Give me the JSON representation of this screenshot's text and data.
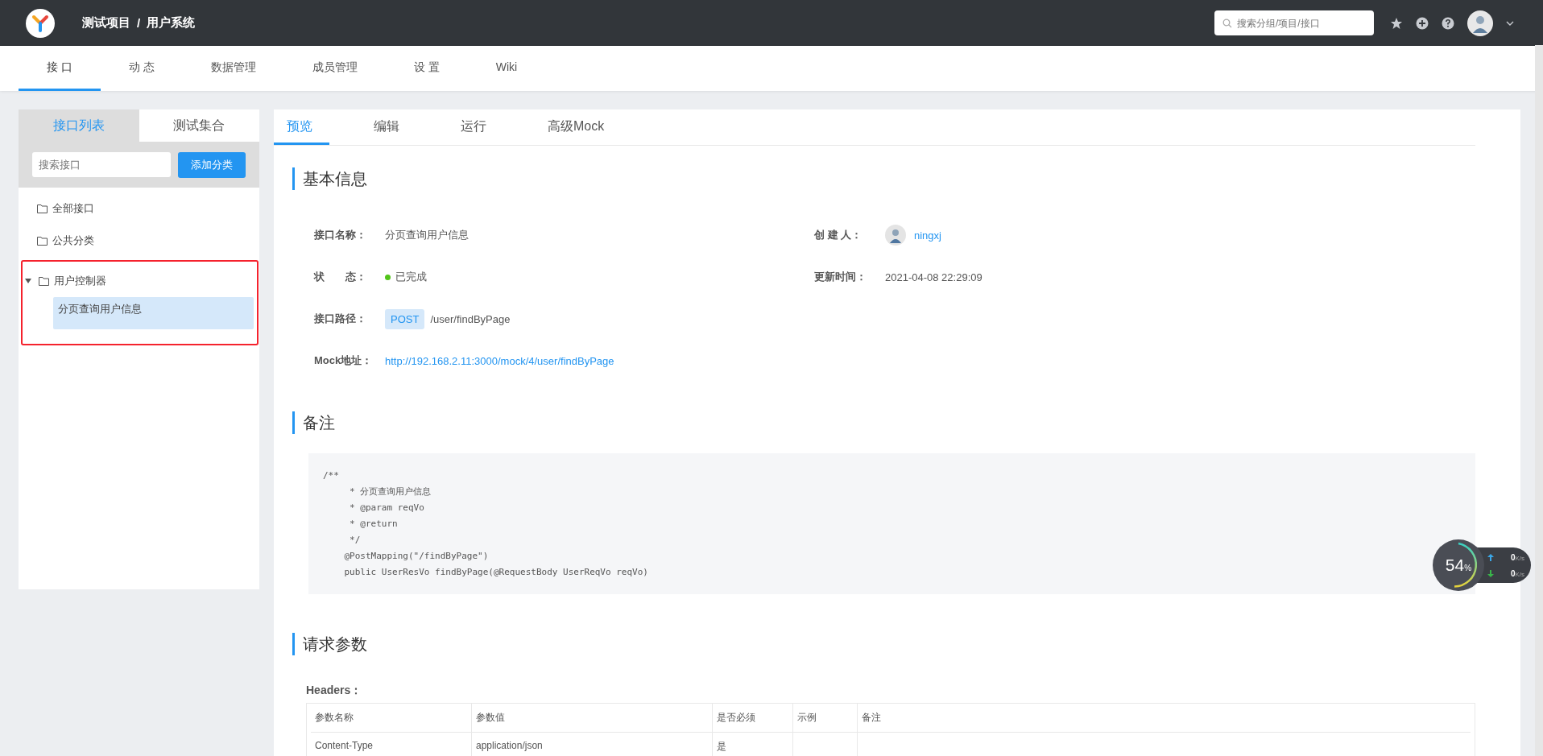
{
  "header": {
    "project": "测试项目",
    "separator": "/",
    "group": "用户系统",
    "search": {
      "placeholder": "搜索分组/项目/接口"
    }
  },
  "nav_tabs": [
    {
      "label": "接 口",
      "selected": true
    },
    {
      "label": "动 态",
      "selected": false
    },
    {
      "label": "数据管理",
      "selected": false
    },
    {
      "label": "成员管理",
      "selected": false
    },
    {
      "label": "设 置",
      "selected": false
    },
    {
      "label": "Wiki",
      "selected": false
    }
  ],
  "sidebar": {
    "tabs": [
      {
        "label": "接口列表",
        "selected": true
      },
      {
        "label": "测试集合",
        "selected": false
      }
    ],
    "search": {
      "placeholder": "搜索接口"
    },
    "add_button": "添加分类",
    "tree": [
      {
        "label": "全部接口"
      },
      {
        "label": "公共分类"
      },
      {
        "label": "用户控制器",
        "highlighted": true,
        "expanded": true,
        "children": [
          {
            "label": "分页查询用户信息",
            "selected": true
          }
        ]
      }
    ]
  },
  "content_tabs": [
    {
      "label": "预览",
      "selected": true
    },
    {
      "label": "编辑",
      "selected": false
    },
    {
      "label": "运行",
      "selected": false
    },
    {
      "label": "高级Mock",
      "selected": false
    }
  ],
  "basic_info": {
    "title": "基本信息",
    "name": {
      "label": "接口名称：",
      "value": "分页查询用户信息"
    },
    "creator": {
      "label": "创 建 人：",
      "value": "ningxj"
    },
    "status": {
      "label": "状　　态：",
      "value": "已完成"
    },
    "updated": {
      "label": "更新时间：",
      "value": "2021-04-08 22:29:09"
    },
    "path": {
      "label": "接口路径：",
      "method": "POST",
      "value": "/user/findByPage"
    },
    "mock": {
      "label": "Mock地址：",
      "value": "http://192.168.2.11:3000/mock/4/user/findByPage"
    }
  },
  "remarks": {
    "title": "备注",
    "code": [
      "/**",
      "     * 分页查询用户信息",
      "     * @param reqVo",
      "     * @return",
      "     */",
      "    @PostMapping(\"/findByPage\")",
      "    public UserResVo findByPage(@RequestBody UserReqVo reqVo)"
    ]
  },
  "request_params": {
    "title": "请求参数",
    "headers_label": "Headers：",
    "columns": [
      "参数名称",
      "参数值",
      "是否必须",
      "示例",
      "备注"
    ],
    "rows": [
      {
        "name": "Content-Type",
        "value": "application/json",
        "required": "是"
      }
    ]
  },
  "monitor": {
    "percent": "54",
    "unit": "%",
    "upload": {
      "value": "0",
      "unit": "K/s"
    },
    "download": {
      "value": "0",
      "unit": "K/s"
    }
  }
}
